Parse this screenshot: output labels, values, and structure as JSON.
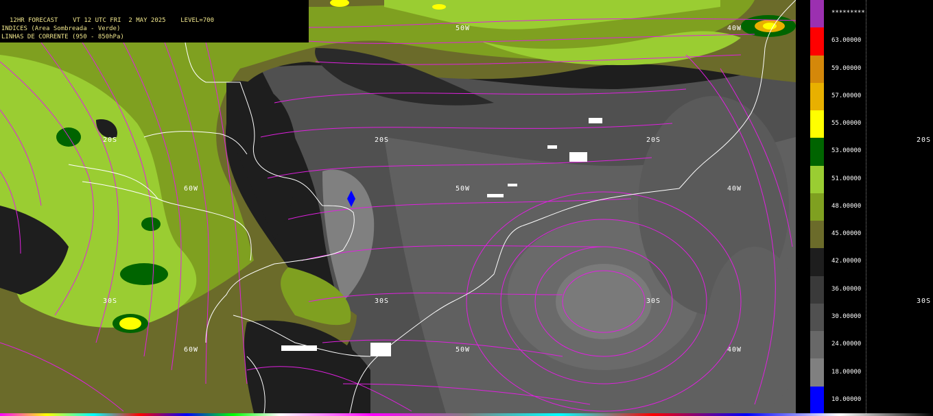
{
  "header": {
    "line1": "12HR FORECAST    VT 12 UTC FRI  2 MAY 2025    LEVEL=700",
    "line2": "INDICES (Area Sombreada - Verde)",
    "line3": "LINHAS DE CORRENTE (950 - 850hPa)"
  },
  "grid_labels": {
    "lat": [
      {
        "text": "20S",
        "id": "lat-20s-west"
      },
      {
        "text": "20S",
        "id": "lat-20s-center"
      },
      {
        "text": "20S",
        "id": "lat-20s-east"
      },
      {
        "text": "30S",
        "id": "lat-30s-west"
      },
      {
        "text": "30S",
        "id": "lat-30s-center"
      },
      {
        "text": "30S",
        "id": "lat-30s-east"
      }
    ],
    "lon": [
      {
        "text": "50W",
        "id": "lon-50w-top"
      },
      {
        "text": "40W",
        "id": "lon-40w-top"
      },
      {
        "text": "60W",
        "id": "lon-60w-mid"
      },
      {
        "text": "50W",
        "id": "lon-50w-mid"
      },
      {
        "text": "40W",
        "id": "lon-40w-mid"
      },
      {
        "text": "60W",
        "id": "lon-60w-bottom"
      },
      {
        "text": "50W",
        "id": "lon-50w-bottom"
      },
      {
        "text": "40W",
        "id": "lon-40w-bottom"
      }
    ],
    "right_edge": [
      {
        "text": "20S",
        "id": "right-20s"
      },
      {
        "text": "30S",
        "id": "right-30s"
      }
    ]
  },
  "legend": {
    "top_label": "*********",
    "entries": [
      {
        "label": "63.00000",
        "color": "#ff0000"
      },
      {
        "label": "59.00000",
        "color": "#d4880a"
      },
      {
        "label": "57.00000",
        "color": "#e8b000"
      },
      {
        "label": "55.00000",
        "color": "#ffff00"
      },
      {
        "label": "53.00000",
        "color": "#006400"
      },
      {
        "label": "51.00000",
        "color": "#9acd32"
      },
      {
        "label": "48.00000",
        "color": "#7fa020"
      },
      {
        "label": "45.00000",
        "color": "#6b6b2a"
      },
      {
        "label": "42.00000",
        "color": "#1e1e1e"
      },
      {
        "label": "36.00000",
        "color": "#3a3a3a"
      },
      {
        "label": "30.00000",
        "color": "#505050"
      },
      {
        "label": "24.00000",
        "color": "#686868"
      },
      {
        "label": "18.00000",
        "color": "#808080"
      },
      {
        "label": "10.00000",
        "color": "#0000ff"
      }
    ],
    "top_color": "#9b30b0"
  },
  "colors": {
    "streamline": "#e020e0",
    "coastline": "#ffffff",
    "header_text": "#f0e68c"
  }
}
